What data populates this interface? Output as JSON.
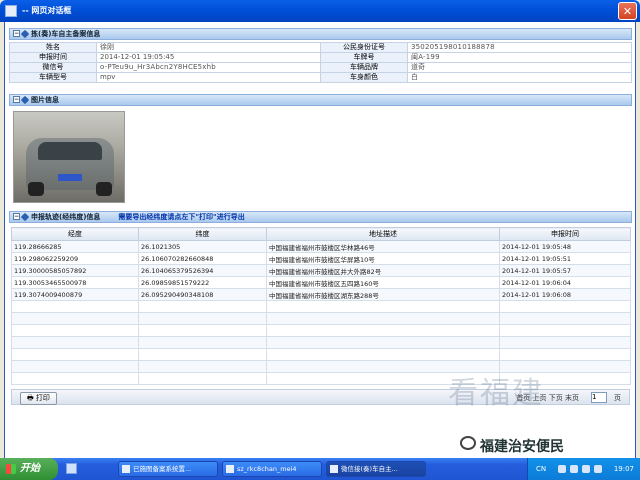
{
  "window": {
    "title": "--  网页对话框",
    "close_glyph": "✕"
  },
  "sections": {
    "owner": "拣(奏)车自主备案信息",
    "photo": "图片信息",
    "track": "申报轨迹(经纬度)信息",
    "track_note": "需要导出经纬度请点左下\"打印\"进行导出"
  },
  "form": {
    "rows": [
      {
        "l1": "姓名",
        "v1": "徐刚",
        "l2": "公民身份证号",
        "v2": "350205198010188878"
      },
      {
        "l1": "申报时间",
        "v1": "2014-12-01 19:05:45",
        "l2": "车牌号",
        "v2": "闽A-199"
      },
      {
        "l1": "微信号",
        "v1": "o-PTeu9u_Hr3Abcn2Y8HCE5xhb",
        "l2": "车辆品牌",
        "v2": "道奇"
      },
      {
        "l1": "车辆型号",
        "v1": "mpv",
        "l2": "车身颜色",
        "v2": "白"
      }
    ]
  },
  "grid": {
    "headers": [
      "经度",
      "纬度",
      "地址描述",
      "申报时间"
    ],
    "rows": [
      [
        "119.28666285",
        "26.1021305",
        "中国福建省福州市鼓楼区华林路46号",
        "2014-12-01 19:05:48"
      ],
      [
        "119.298062259209",
        "26.106070282660848",
        "中国福建省福州市鼓楼区华屏路10号",
        "2014-12-01 19:05:51"
      ],
      [
        "119.30000585057892",
        "26.104065379526394",
        "中国福建省福州市鼓楼区井大外路82号",
        "2014-12-01 19:05:57"
      ],
      [
        "119.30053465500978",
        "26.09859851579222",
        "中国福建省福州市鼓楼区五四路160号",
        "2014-12-01 19:06:04"
      ],
      [
        "119.3074009400879",
        "26.095290490348108",
        "中国福建省福州市鼓楼区湖东路288号",
        "2014-12-01 19:06:08"
      ]
    ]
  },
  "pager": {
    "print_label": "打印",
    "prefix": "首页  上页  下页  末页",
    "page_value": "1",
    "suffix": "页"
  },
  "watermark": {
    "text1": "看福建",
    "text2": "福建治安便民"
  },
  "taskbar": {
    "start_label": "开始",
    "tasks": [
      "已施图备案系统置...",
      "sz_rkc8chan_mei4",
      "微信接(奏)车自主..."
    ],
    "tray_lang": "CN",
    "clock": "19:07"
  }
}
